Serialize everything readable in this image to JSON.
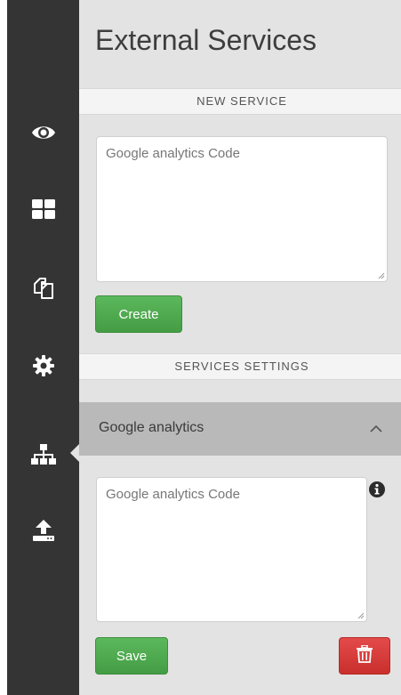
{
  "page": {
    "title": "External Services"
  },
  "sidebar": {
    "items": [
      {
        "icon": "eye-icon",
        "active": false
      },
      {
        "icon": "grid-icon",
        "active": false
      },
      {
        "icon": "copy-icon",
        "active": false
      },
      {
        "icon": "gear-icon",
        "active": false
      },
      {
        "icon": "sitemap-icon",
        "active": true
      },
      {
        "icon": "upload-icon",
        "active": false
      }
    ]
  },
  "new_service": {
    "header": "NEW SERVICE",
    "code_placeholder": "Google analytics Code",
    "code_value": "",
    "create_label": "Create"
  },
  "services_settings": {
    "header": "SERVICES SETTINGS",
    "services": [
      {
        "name": "Google analytics",
        "expanded": true,
        "code_placeholder": "Google analytics Code",
        "code_value": "",
        "save_label": "Save",
        "info_icon": "info-icon",
        "delete_icon": "trash-icon"
      }
    ]
  },
  "colors": {
    "sidebar_bg": "#343434",
    "content_bg": "#e3e3e3",
    "accordion_bg": "#b9b9b9",
    "success": "#5cb85c",
    "danger": "#d9363e"
  }
}
